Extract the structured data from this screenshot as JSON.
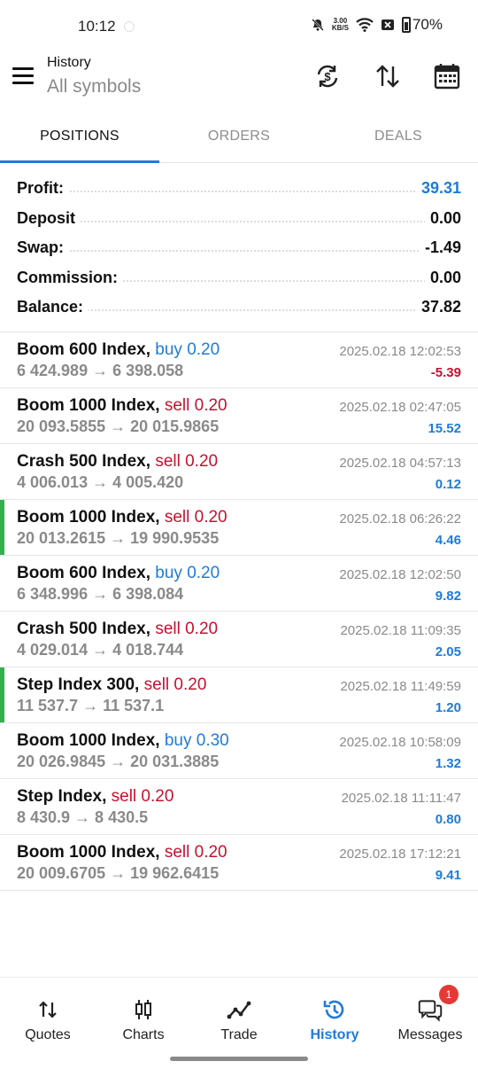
{
  "status_bar": {
    "time": "10:12",
    "net_speed_value": "3.00",
    "net_speed_unit": "KB/S",
    "battery": "70%"
  },
  "header": {
    "title": "History",
    "subtitle": "All symbols",
    "icons": [
      "currency-sync-icon",
      "sort-icon",
      "calendar-icon"
    ]
  },
  "tabs": [
    {
      "label": "POSITIONS",
      "active": true
    },
    {
      "label": "ORDERS",
      "active": false
    },
    {
      "label": "DEALS",
      "active": false
    }
  ],
  "summary": [
    {
      "label": "Profit:",
      "value": "39.31"
    },
    {
      "label": "Deposit",
      "value": "0.00"
    },
    {
      "label": "Swap:",
      "value": "-1.49"
    },
    {
      "label": "Commission:",
      "value": "0.00"
    },
    {
      "label": "Balance:",
      "value": "37.82"
    }
  ],
  "positions": [
    {
      "symbol": "Boom 600 Index,",
      "side": "buy 0.20",
      "prices": "6 424.989 → 6 398.058",
      "time": "2025.02.18 12:02:53",
      "profit": "-5.39"
    },
    {
      "symbol": "Boom 1000 Index,",
      "side": "sell 0.20",
      "prices": "20 093.5855 → 20 015.9865",
      "time": "2025.02.18 02:47:05",
      "profit": "15.52"
    },
    {
      "symbol": "Crash 500 Index,",
      "side": "sell 0.20",
      "prices": "4 006.013 → 4 005.420",
      "time": "2025.02.18 04:57:13",
      "profit": "0.12"
    },
    {
      "symbol": "Boom 1000 Index,",
      "side": "sell 0.20",
      "prices": "20 013.2615 → 19 990.9535",
      "time": "2025.02.18 06:26:22",
      "profit": "4.46"
    },
    {
      "symbol": "Boom 600 Index,",
      "side": "buy 0.20",
      "prices": "6 348.996 → 6 398.084",
      "time": "2025.02.18 12:02:50",
      "profit": "9.82"
    },
    {
      "symbol": "Crash 500 Index,",
      "side": "sell 0.20",
      "prices": "4 029.014 → 4 018.744",
      "time": "2025.02.18 11:09:35",
      "profit": "2.05"
    },
    {
      "symbol": "Step Index 300,",
      "side": "sell 0.20",
      "prices": "11 537.7 → 11 537.1",
      "time": "2025.02.18 11:49:59",
      "profit": "1.20"
    },
    {
      "symbol": "Boom 1000 Index,",
      "side": "buy 0.30",
      "prices": "20 026.9845 → 20 031.3885",
      "time": "2025.02.18 10:58:09",
      "profit": "1.32"
    },
    {
      "symbol": "Step Index,",
      "side": "sell 0.20",
      "prices": "8 430.9 → 8 430.5",
      "time": "2025.02.18 11:11:47",
      "profit": "0.80"
    },
    {
      "symbol": "Boom 1000 Index,",
      "side": "sell 0.20",
      "prices": "20 009.6705 → 19 962.6415",
      "time": "2025.02.18 17:12:21",
      "profit": "9.41"
    }
  ],
  "bottom_nav": [
    {
      "label": "Quotes",
      "icon": "quotes-icon",
      "active": false
    },
    {
      "label": "Charts",
      "icon": "charts-icon",
      "active": false
    },
    {
      "label": "Trade",
      "icon": "trade-icon",
      "active": false
    },
    {
      "label": "History",
      "icon": "history-icon",
      "active": true
    },
    {
      "label": "Messages",
      "icon": "messages-icon",
      "active": false,
      "badge": "1"
    }
  ],
  "colors": {
    "accent": "#1f7bd8",
    "loss": "#c8102e",
    "flag": "#2fb24c",
    "badge": "#e53935"
  }
}
